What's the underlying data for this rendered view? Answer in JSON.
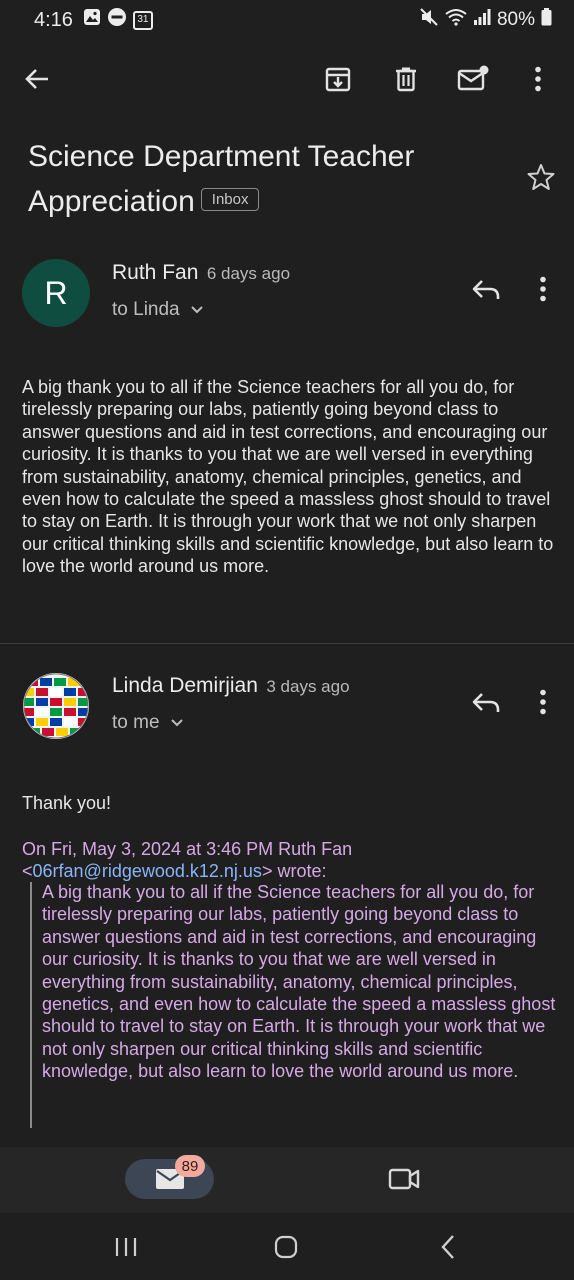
{
  "status_bar": {
    "time": "4:16",
    "calendar_date": "31",
    "battery": "80%",
    "icons": [
      "image-icon",
      "do-not-disturb-icon",
      "calendar-icon",
      "mute-icon",
      "wifi-icon",
      "signal-icon",
      "battery-icon"
    ]
  },
  "toolbar": {
    "icons": [
      "back-arrow-icon",
      "archive-icon",
      "delete-icon",
      "mark-unread-icon",
      "more-vert-icon"
    ]
  },
  "email": {
    "subject": "Science Department Teacher Appreciation",
    "label": "Inbox"
  },
  "messages": [
    {
      "avatar_letter": "R",
      "avatar_color": "#0f4d40",
      "sender": "Ruth Fan",
      "time": "6 days ago",
      "recipient": "to Linda",
      "body": "A big thank you to all if the Science teachers for all you do, for tirelessly preparing our labs, patiently going beyond class to answer questions and aid in test corrections, and encouraging our curiosity. It is thanks to you that we are well versed in everything from sustainability, anatomy, chemical principles, genetics, and even how to calculate the speed a massless ghost should to travel to stay on Earth. It is through your work that we not only sharpen our critical thinking skills and scientific knowledge, but also learn to love the world around us more."
    },
    {
      "sender": "Linda Demirjian",
      "time": "3 days ago",
      "recipient": "to me",
      "body": "Thank you!",
      "quote": {
        "header_prefix": "On Fri, May 3, 2024 at 3:46 PM Ruth Fan",
        "email_open": "<",
        "email": "06rfan@ridgewood.k12.nj.us",
        "header_suffix": "> wrote:",
        "text": "A big thank you to all if the Science teachers for all you do, for tirelessly preparing our labs, patiently going beyond class to answer questions and aid in test corrections, and encouraging our curiosity. It is thanks to you that we are well versed in everything from sustainability, anatomy, chemical principles, genetics, and even how to calculate the speed a massless ghost should to travel to stay on Earth. It is through your work that we not only sharpen our critical thinking skills and scientific knowledge, but also learn to love the world around us more."
      }
    }
  ],
  "bottom_nav": {
    "mail_badge": "89"
  },
  "colors": {
    "background": "#1f1f1f",
    "quote_text": "#d6a8e6",
    "link": "#8ab4f8",
    "badge": "#f1aaa0"
  }
}
